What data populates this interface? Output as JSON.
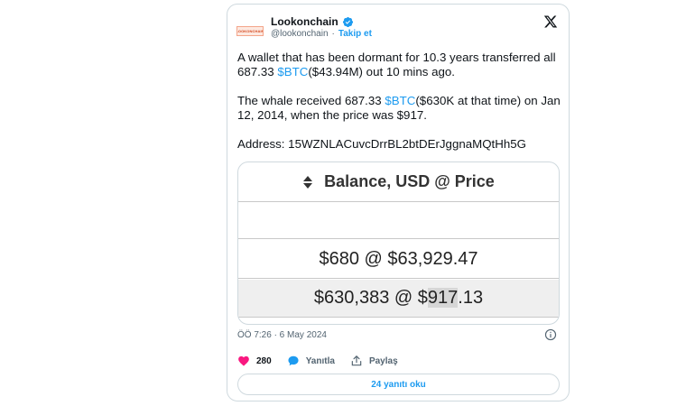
{
  "author": {
    "avatar_text": "LOOKONCHAIN",
    "name": "Lookonchain",
    "handle": "@lookonchain",
    "separator": "·",
    "follow_label": "Takip et"
  },
  "tweet": {
    "p1_a": "A wallet that has been dormant for 10.3 years transferred all 687.33 ",
    "p1_tag": "$BTC",
    "p1_b": "($43.94M) out 10 mins ago.",
    "p2_a": "The whale received 687.33 ",
    "p2_tag": "$BTC",
    "p2_b": "($630K at that time) on Jan 12, 2014, when the price was $917.",
    "p3": "Address: 15WZNLACuvcDrrBL2btDErJggnaMQtHh5G"
  },
  "table": {
    "header": "Balance, USD @ Price",
    "row1": "$680 @ $63,929.47",
    "row2_pre": "$630,383 @ $",
    "row2_hl": "917",
    "row2_post": ".13"
  },
  "meta": {
    "timestamp": "ÖÖ 7:26 · 6 May 2024"
  },
  "actions": {
    "likes": "280",
    "reply_label": "Yanıtla",
    "share_label": "Paylaş"
  },
  "replies_button": "24 yanıtı oku",
  "colors": {
    "accent": "#1d9bf0",
    "like": "#f91880",
    "text": "#0f1419",
    "muted": "#536471"
  }
}
